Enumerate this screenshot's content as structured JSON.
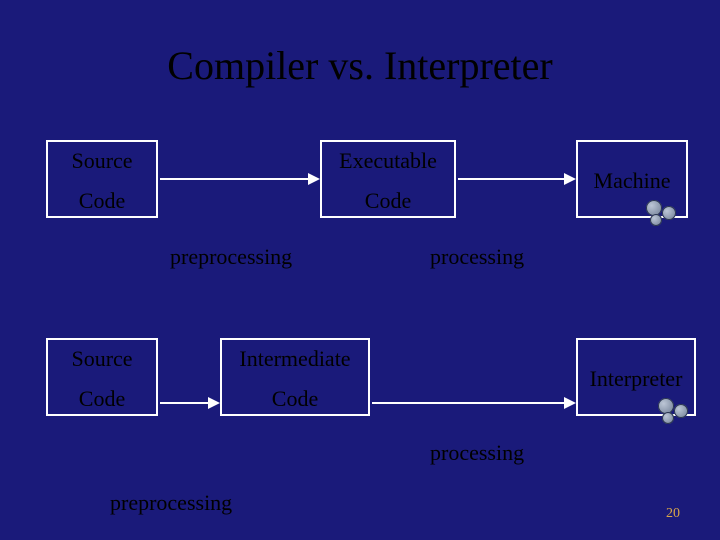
{
  "title": "Compiler vs. Interpreter",
  "top": {
    "source_l1": "Source",
    "source_l2": "Code",
    "exec_l1": "Executable",
    "exec_l2": "Code",
    "machine": "Machine",
    "preprocessing": "preprocessing",
    "processing": "processing"
  },
  "bottom": {
    "source_l1": "Source",
    "source_l2": "Code",
    "inter_l1": "Intermediate",
    "inter_l2": "Code",
    "interpreter": "Interpreter",
    "preprocessing": "preprocessing",
    "processing": "processing"
  },
  "page_number": "20"
}
